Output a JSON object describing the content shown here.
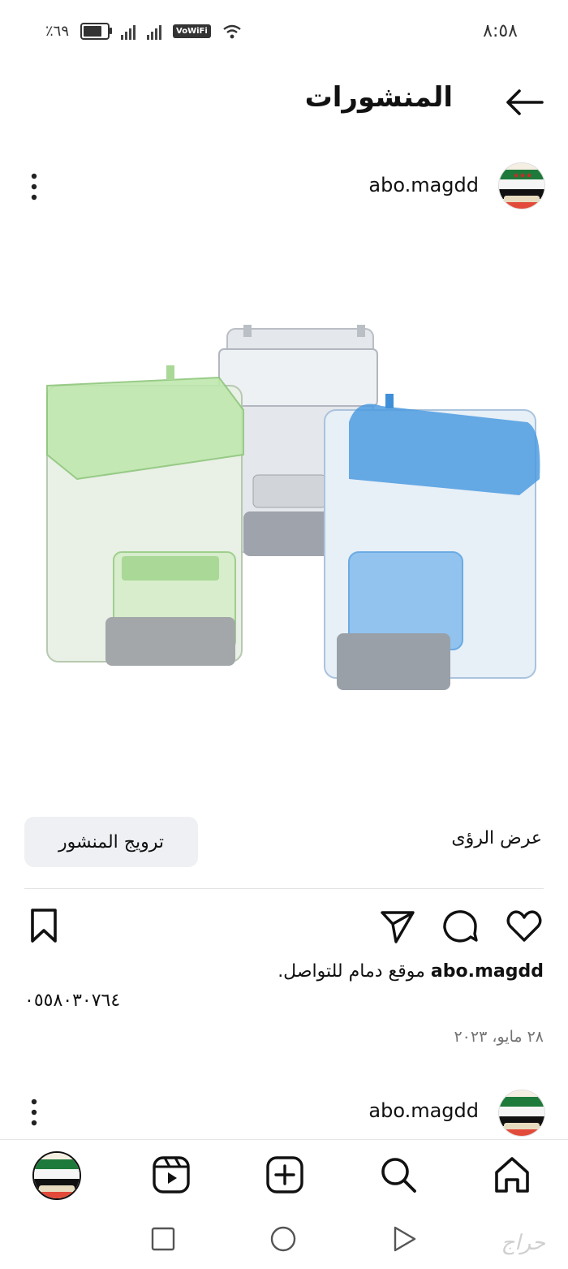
{
  "status_bar": {
    "time": "٨:٥٨",
    "battery": "٪٦٩",
    "wifi_badge": "VoWiFi"
  },
  "header": {
    "title": "المنشورات",
    "back_icon": "arrow-right-icon"
  },
  "post": {
    "username": "abo.magdd",
    "promote_label": "ترويج المنشور",
    "insights_label": "عرض الرؤى",
    "caption_user": "abo.magdd",
    "caption_text": "موقع دمام للتواصل.",
    "phone": "٠٥٥٨٠٣٠٧٦٤",
    "date": "٢٨ مايو، ٢٠٢٣"
  },
  "next_post": {
    "username": "abo.magdd"
  },
  "bottom_nav": {
    "items": [
      "home-icon",
      "search-icon",
      "create-icon",
      "reels-icon",
      "profile-avatar"
    ]
  },
  "watermark": "حراج",
  "colors": {
    "feeder_green": "#b8e6a8",
    "feeder_blue": "#3f8fd8",
    "feeder_clear": "#d8dde3"
  }
}
